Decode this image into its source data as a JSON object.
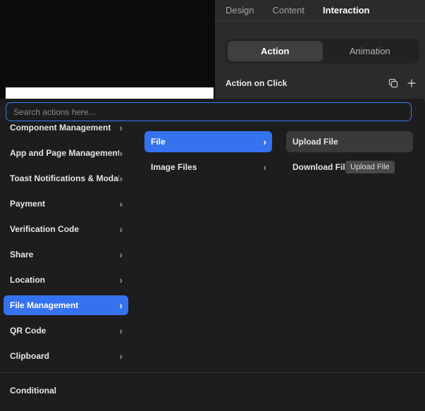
{
  "inspector": {
    "tabs": [
      {
        "label": "Design"
      },
      {
        "label": "Content"
      },
      {
        "label": "Interaction"
      }
    ],
    "mode_tabs": [
      {
        "label": "Action"
      },
      {
        "label": "Animation"
      }
    ],
    "section": {
      "title": "Action on Click"
    }
  },
  "action_menu": {
    "search": {
      "placeholder": "Search actions here..."
    },
    "categories": [
      "Component Management",
      "App and Page Management",
      "Toast Notifications & Modal",
      "Payment",
      "Verification Code",
      "Share",
      "Location",
      "File Management",
      "QR Code",
      "Clipboard"
    ],
    "footer": "Conditional",
    "submenu": [
      "File",
      "Image Files"
    ],
    "actions": [
      "Upload File",
      "Download File"
    ],
    "tooltip": "Upload File"
  },
  "colors": {
    "accent_blue": "#3572f0",
    "panel_bg": "#2b2b2b",
    "menu_bg": "#1d1d1d",
    "hover_gray": "#3a3a3a",
    "canvas_black": "#0b0b0b"
  }
}
